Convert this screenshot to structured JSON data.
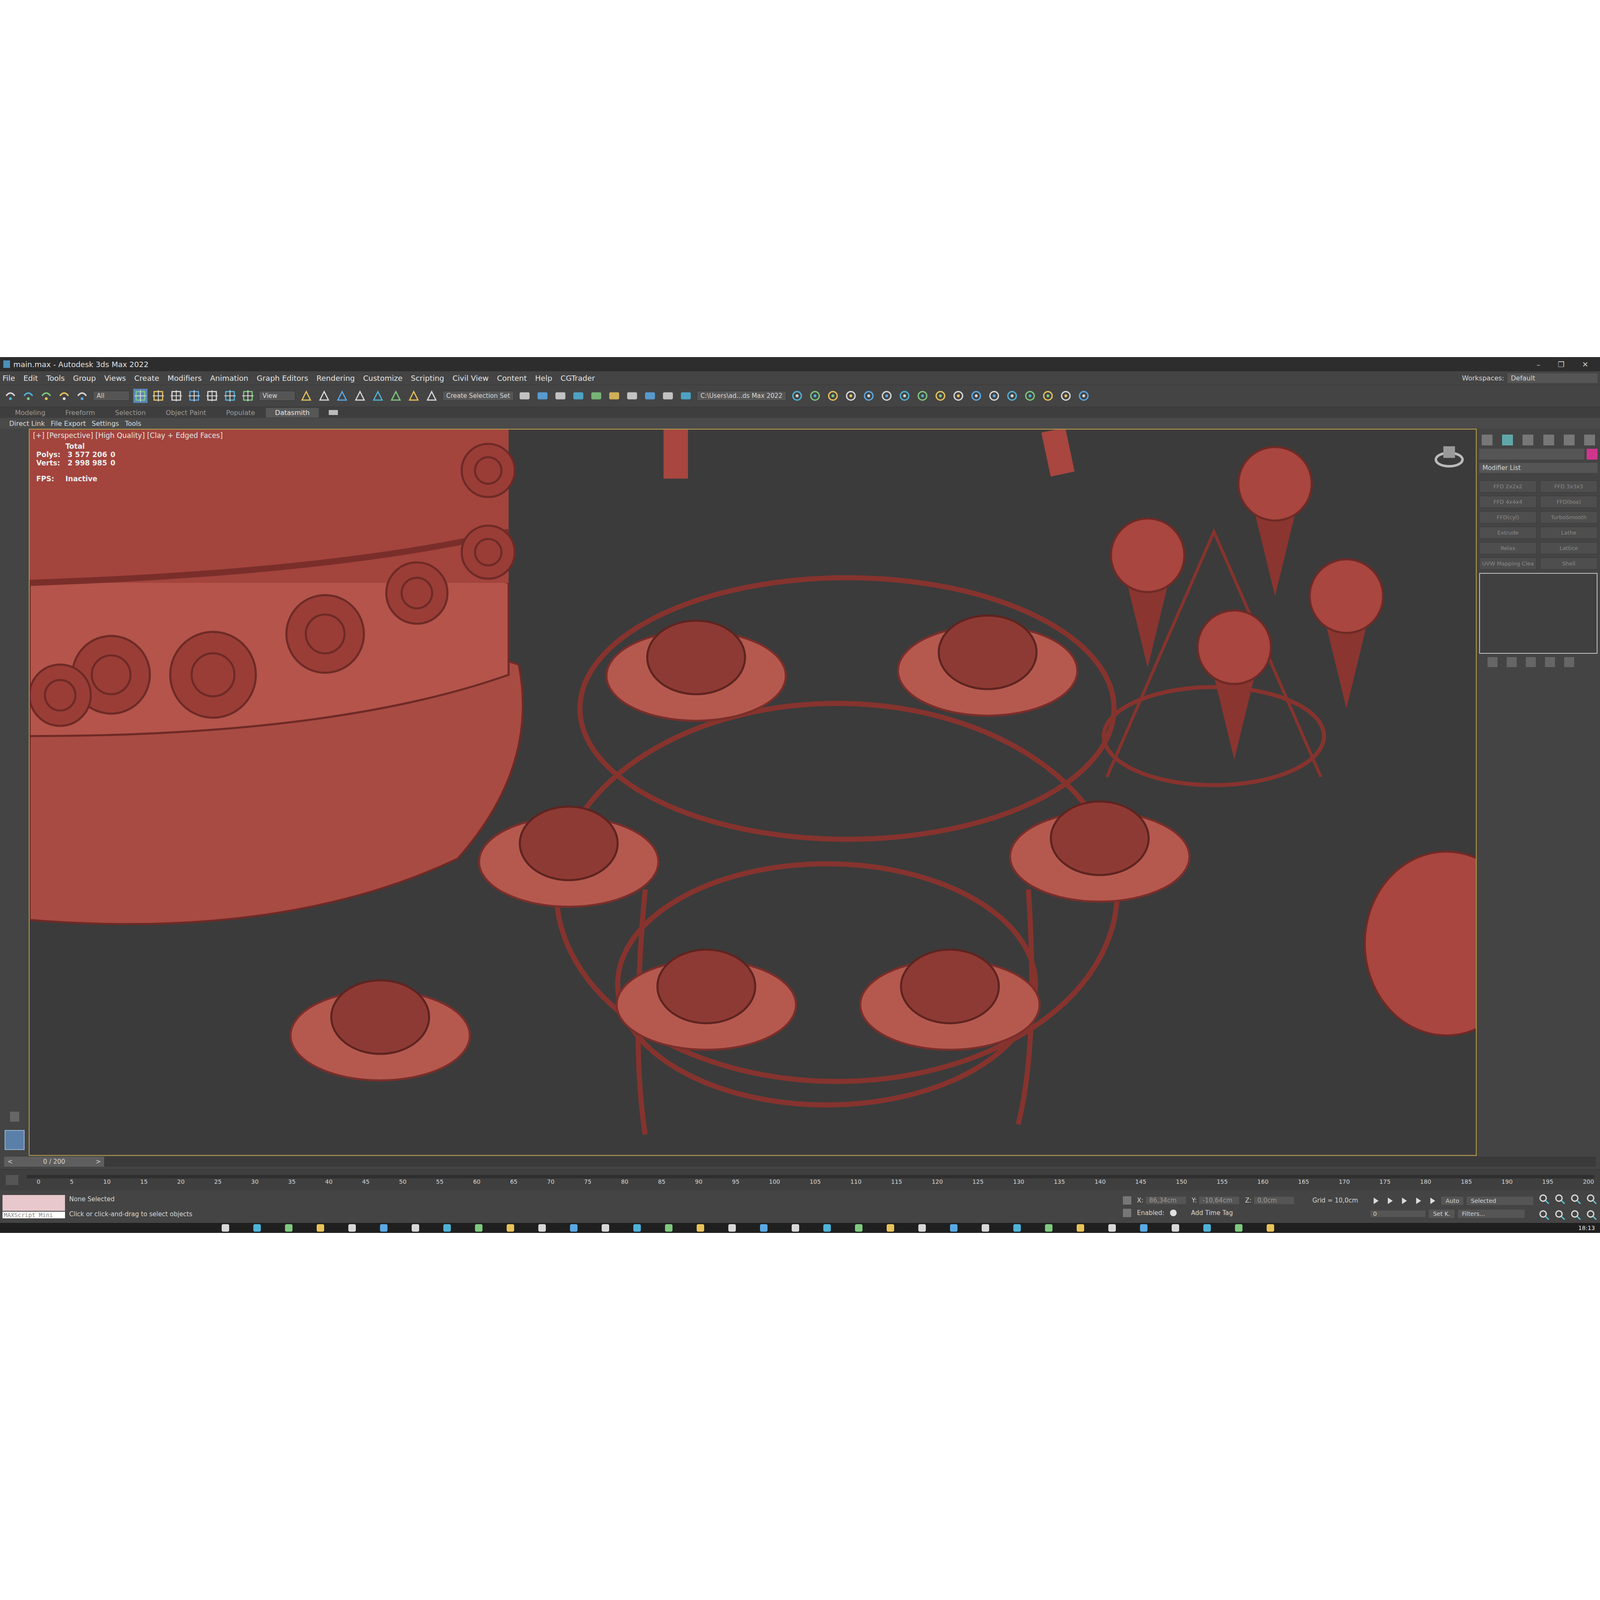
{
  "window": {
    "title": "main.max - Autodesk 3ds Max 2022",
    "controls": [
      "–",
      "❐",
      "✕"
    ]
  },
  "menu": [
    "File",
    "Edit",
    "Tools",
    "Group",
    "Views",
    "Create",
    "Modifiers",
    "Animation",
    "Graph Editors",
    "Rendering",
    "Customize",
    "Scripting",
    "Civil View",
    "Content",
    "Help",
    "CGTrader"
  ],
  "workspace": {
    "label": "Workspaces:",
    "value": "Default"
  },
  "toolbar": {
    "filter": "All",
    "ref_coord": "View",
    "selection_set": "Create Selection Set",
    "project": "C:\\Users\\ad...ds Max 2022"
  },
  "ribbon_tabs": [
    {
      "label": "Modeling",
      "selected": false
    },
    {
      "label": "Freeform",
      "selected": false
    },
    {
      "label": "Selection",
      "selected": false
    },
    {
      "label": "Object Paint",
      "selected": false
    },
    {
      "label": "Populate",
      "selected": false
    },
    {
      "label": "Datasmith",
      "selected": true
    }
  ],
  "sub_tabs": [
    "Direct Link",
    "File Export",
    "Settings",
    "Tools"
  ],
  "viewport": {
    "label": "[+] [Perspective] [High Quality] [Clay + Edged Faces]",
    "stats_header": "Total",
    "stats": [
      {
        "label": "Polys:",
        "total": "3 577 206",
        "selected": "0"
      },
      {
        "label": "Verts:",
        "total": "2 998 985",
        "selected": "0"
      }
    ],
    "fps_label": "FPS:",
    "fps": "Inactive"
  },
  "command_panel": {
    "modifier_list": "Modifier List",
    "buttons": [
      {
        "label": "FFD 2x2x2",
        "disabled": true
      },
      {
        "label": "FFD 3x3x3",
        "disabled": true
      },
      {
        "label": "FFD 4x4x4",
        "disabled": true
      },
      {
        "label": "FFD(box)",
        "disabled": true
      },
      {
        "label": "FFD(cyl)",
        "disabled": true
      },
      {
        "label": "TurboSmooth",
        "disabled": true
      },
      {
        "label": "Extrude",
        "disabled": true
      },
      {
        "label": "Lathe",
        "disabled": true
      },
      {
        "label": "Relax",
        "disabled": true
      },
      {
        "label": "Lattice",
        "disabled": true
      },
      {
        "label": "UVW Mapping Clea",
        "disabled": true
      },
      {
        "label": "Shell",
        "disabled": true
      }
    ]
  },
  "time_slider": {
    "reading": "0 / 200",
    "prev": "<",
    "next": ">",
    "level": 0
  },
  "ruler": {
    "ticks": [
      "0",
      "5",
      "10",
      "15",
      "20",
      "25",
      "30",
      "35",
      "40",
      "45",
      "50",
      "55",
      "60",
      "65",
      "70",
      "75",
      "80",
      "85",
      "90",
      "95",
      "100",
      "105",
      "110",
      "115",
      "120",
      "125",
      "130",
      "135",
      "140",
      "145",
      "150",
      "155",
      "160",
      "165",
      "170",
      "175",
      "180",
      "185",
      "190",
      "195",
      "200"
    ]
  },
  "status": {
    "selection": "None Selected",
    "prompt": "Click or click-and-drag to select objects",
    "maxscript": "MAXScript Mini",
    "coords": [
      {
        "label": "X:",
        "value": "86,34cm"
      },
      {
        "label": "Y:",
        "value": "-10,64cm"
      },
      {
        "label": "Z:",
        "value": "0,0cm"
      }
    ],
    "grid": "Grid = 10,0cm",
    "enabled": "Enabled:",
    "time_tag": "Add Time Tag",
    "key_mode": "Auto",
    "key_filter": "Selected",
    "set_key": "Set K.",
    "filters": "Filters...",
    "frame": "0"
  },
  "taskbar": {
    "clock": "18:13"
  }
}
